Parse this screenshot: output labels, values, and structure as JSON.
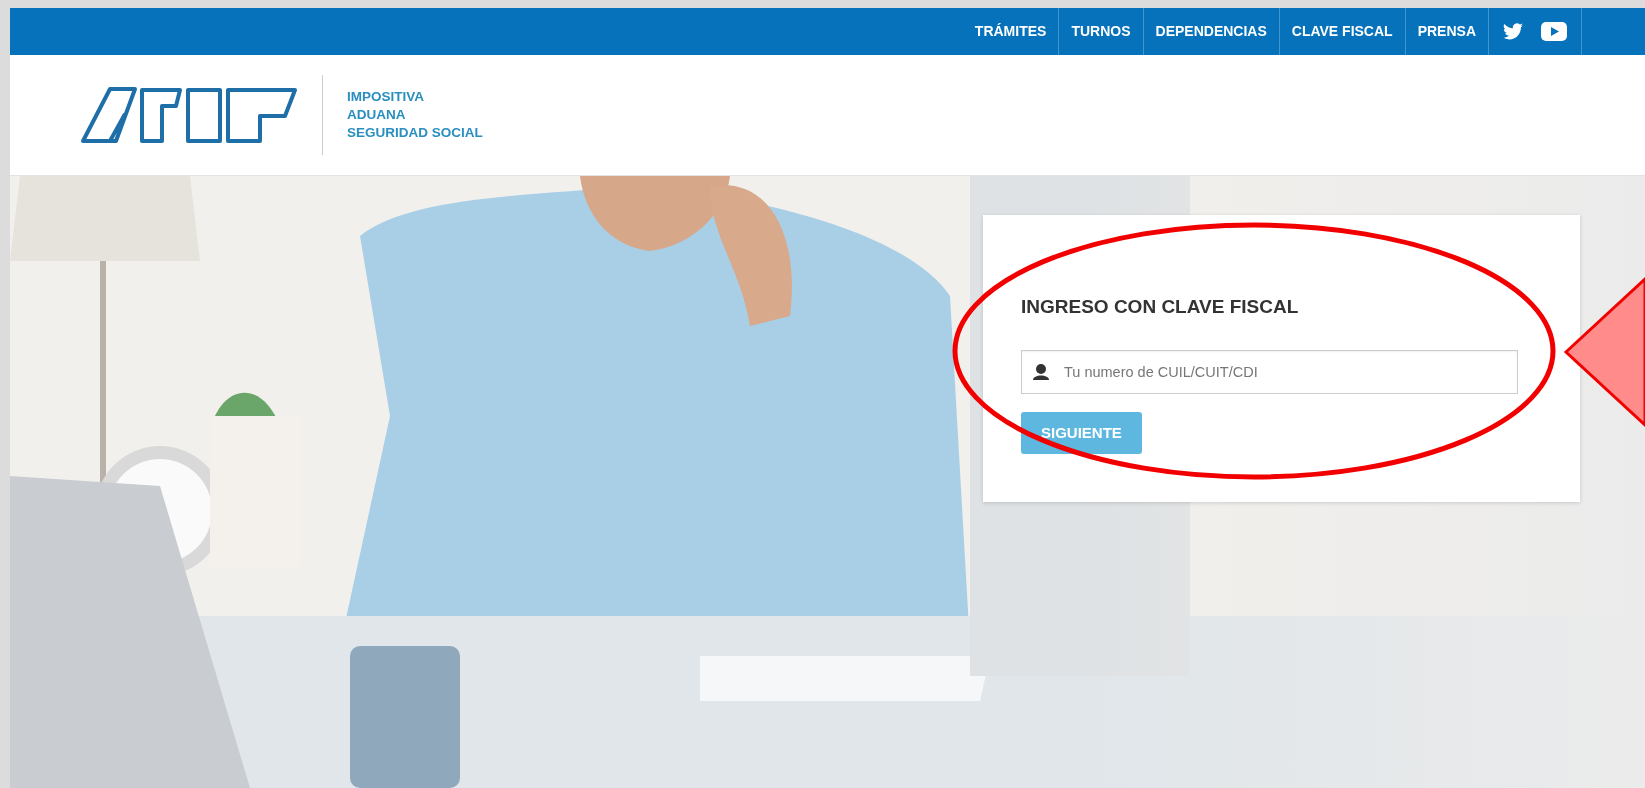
{
  "top_nav": {
    "links": [
      {
        "label": "TRÁMITES"
      },
      {
        "label": "TURNOS"
      },
      {
        "label": "DEPENDENCIAS"
      },
      {
        "label": "CLAVE FISCAL"
      },
      {
        "label": "PRENSA"
      }
    ]
  },
  "header": {
    "taglines": [
      "IMPOSITIVA",
      "ADUANA",
      "SEGURIDAD SOCIAL"
    ]
  },
  "login": {
    "title": "INGRESO CON CLAVE FISCAL",
    "field": {
      "placeholder": "Tu numero de CUIL/CUIT/CDI"
    },
    "button": "SIGUIENTE"
  },
  "annotations": [
    {
      "kind": "ellipse"
    },
    {
      "kind": "arrow"
    }
  ]
}
